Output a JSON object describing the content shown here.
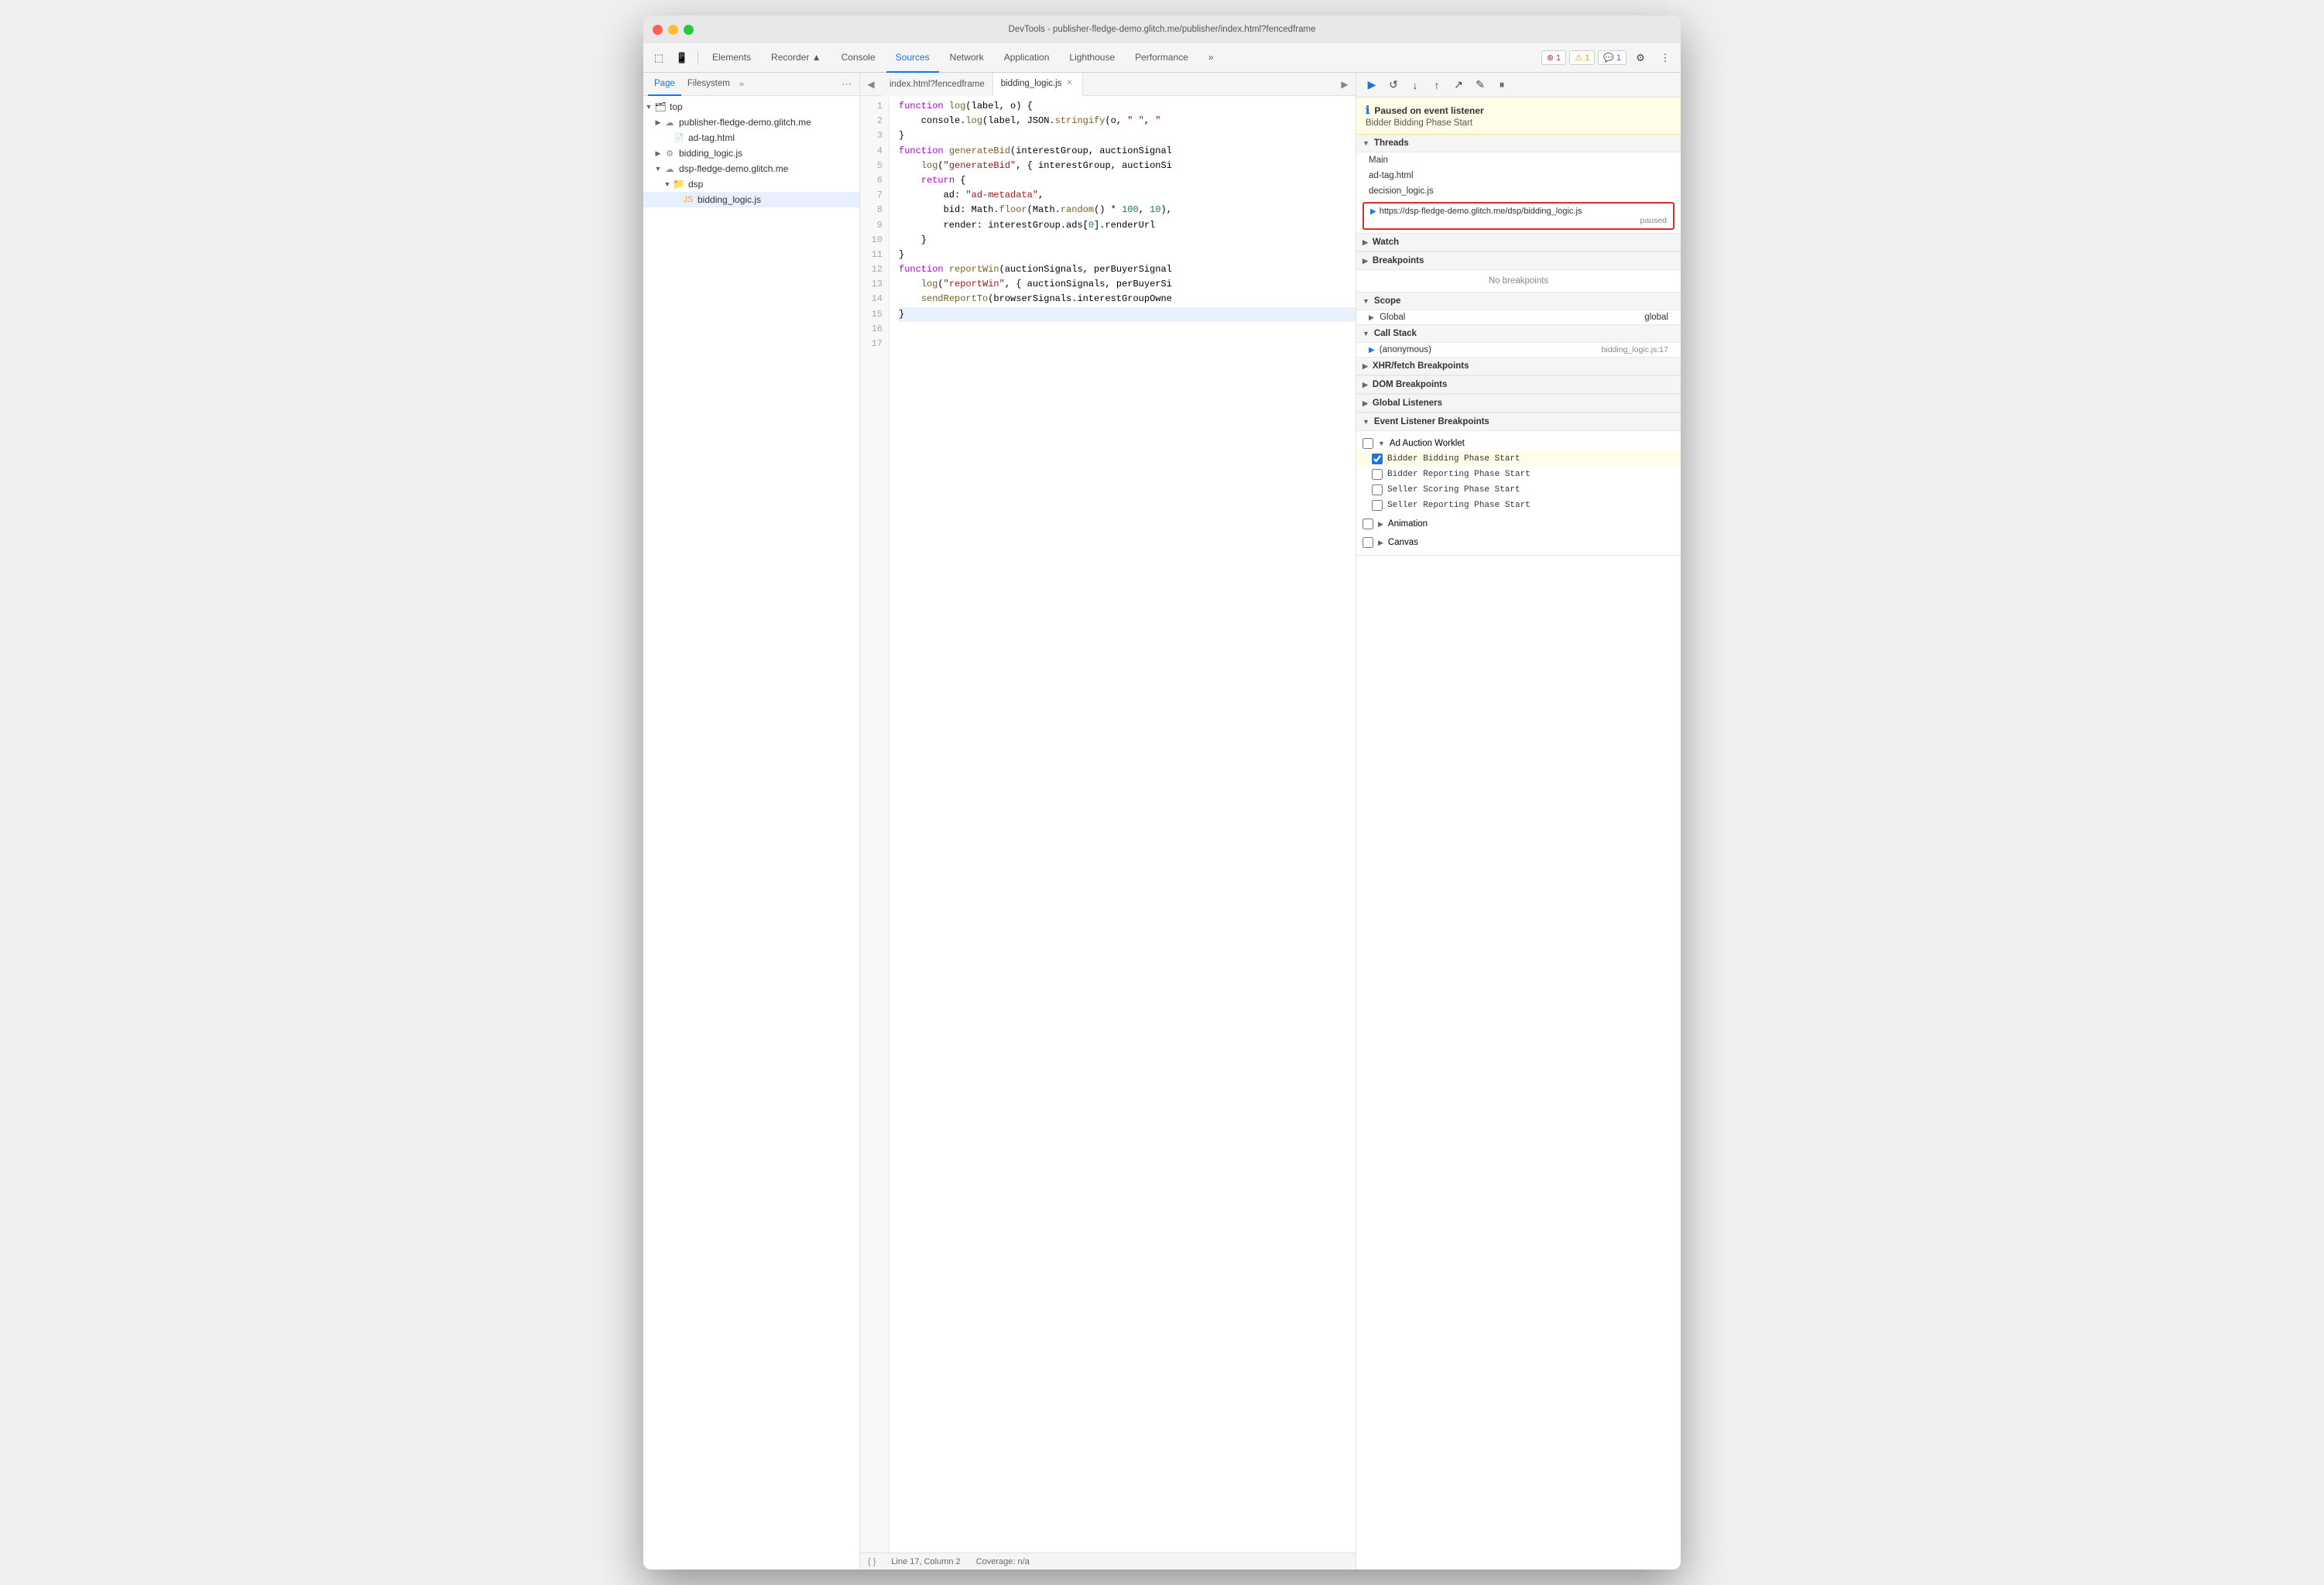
{
  "window": {
    "title": "DevTools - publisher-fledge-demo.glitch.me/publisher/index.html?fencedframe"
  },
  "toolbar": {
    "tabs": [
      "Elements",
      "Recorder ▲",
      "Console",
      "Sources",
      "Network",
      "Application",
      "Lighthouse",
      "Performance",
      "»"
    ],
    "active_tab": "Sources",
    "badge_error": "1",
    "badge_warn": "1",
    "badge_info": "1"
  },
  "panel_left": {
    "tabs": [
      "Page",
      "Filesystem",
      "»"
    ],
    "active_tab": "Page",
    "tree": [
      {
        "label": "top",
        "level": 0,
        "type": "root",
        "expanded": true
      },
      {
        "label": "publisher-fledge-demo.glitch.me",
        "level": 1,
        "type": "cloud",
        "expanded": false
      },
      {
        "label": "ad-tag.html",
        "level": 2,
        "type": "file"
      },
      {
        "label": "bidding_logic.js",
        "level": 1,
        "type": "gear",
        "expanded": false,
        "selected": true
      },
      {
        "label": "dsp-fledge-demo.glitch.me",
        "level": 2,
        "type": "cloud",
        "expanded": true
      },
      {
        "label": "dsp",
        "level": 3,
        "type": "folder",
        "expanded": true
      },
      {
        "label": "bidding_logic.js",
        "level": 4,
        "type": "file-js",
        "selected": true
      }
    ]
  },
  "editor": {
    "tabs": [
      {
        "label": "index.html?fencedframe",
        "active": false,
        "closeable": false
      },
      {
        "label": "bidding_logic.js",
        "active": true,
        "closeable": true
      }
    ],
    "lines": [
      {
        "num": 1,
        "code": "function log(label, o) {"
      },
      {
        "num": 2,
        "code": "    console.log(label, JSON.stringify(o, \" \", \""
      },
      {
        "num": 3,
        "code": "}"
      },
      {
        "num": 4,
        "code": ""
      },
      {
        "num": 5,
        "code": "function generateBid(interestGroup, auctionSignal"
      },
      {
        "num": 6,
        "code": "    log(\"generateBid\", { interestGroup, auctionSi"
      },
      {
        "num": 7,
        "code": "    return {"
      },
      {
        "num": 8,
        "code": "        ad: \"ad-metadata\","
      },
      {
        "num": 9,
        "code": "        bid: Math.floor(Math.random() * 100, 10),"
      },
      {
        "num": 10,
        "code": "        render: interestGroup.ads[0].renderUrl"
      },
      {
        "num": 11,
        "code": "    }"
      },
      {
        "num": 12,
        "code": "}"
      },
      {
        "num": 13,
        "code": ""
      },
      {
        "num": 14,
        "code": "function reportWin(auctionSignals, perBuyerSignal"
      },
      {
        "num": 15,
        "code": "    log(\"reportWin\", { auctionSignals, perBuyerSi"
      },
      {
        "num": 16,
        "code": "    sendReportTo(browserSignals.interestGroupOwne"
      },
      {
        "num": 17,
        "code": "}",
        "highlighted": true
      }
    ],
    "status": {
      "line": "Line 17, Column 2",
      "coverage": "Coverage: n/a"
    }
  },
  "debugger": {
    "toolbar_btns": [
      "▶",
      "↺",
      "↓",
      "↑",
      "↗",
      "✎",
      "⏸"
    ],
    "paused": {
      "title": "Paused on event listener",
      "subtitle": "Bidder Bidding Phase Start"
    },
    "threads": {
      "label": "Threads",
      "items": [
        {
          "label": "Main",
          "type": "main"
        },
        {
          "label": "ad-tag.html",
          "type": "tag"
        },
        {
          "label": "decision_logic.js",
          "type": "script"
        },
        {
          "url": "https://dsp-fledge-demo.glitch.me/dsp/bidding_logic.js",
          "status": "paused",
          "highlighted": true
        }
      ]
    },
    "watch": {
      "label": "Watch"
    },
    "breakpoints": {
      "label": "Breakpoints",
      "no_breakpoints": "No breakpoints"
    },
    "scope": {
      "label": "Scope",
      "items": [
        {
          "label": "▶ Global",
          "value": "global"
        }
      ]
    },
    "call_stack": {
      "label": "Call Stack",
      "items": [
        {
          "label": "(anonymous)",
          "location": "bidding_logic.js:17",
          "is_arrow": true
        }
      ]
    },
    "xhr_breakpoints": {
      "label": "XHR/fetch Breakpoints"
    },
    "dom_breakpoints": {
      "label": "DOM Breakpoints"
    },
    "global_listeners": {
      "label": "Global Listeners"
    },
    "event_listener_breakpoints": {
      "label": "Event Listener Breakpoints",
      "groups": [
        {
          "label": "Ad Auction Worklet",
          "expanded": true,
          "items": [
            {
              "label": "Bidder Bidding Phase Start",
              "checked": true,
              "highlighted": true
            },
            {
              "label": "Bidder Reporting Phase Start",
              "checked": false
            },
            {
              "label": "Seller Scoring Phase Start",
              "checked": false
            },
            {
              "label": "Seller Reporting Phase Start",
              "checked": false
            }
          ]
        },
        {
          "label": "Animation",
          "expanded": false
        },
        {
          "label": "Canvas",
          "expanded": false
        }
      ]
    }
  }
}
